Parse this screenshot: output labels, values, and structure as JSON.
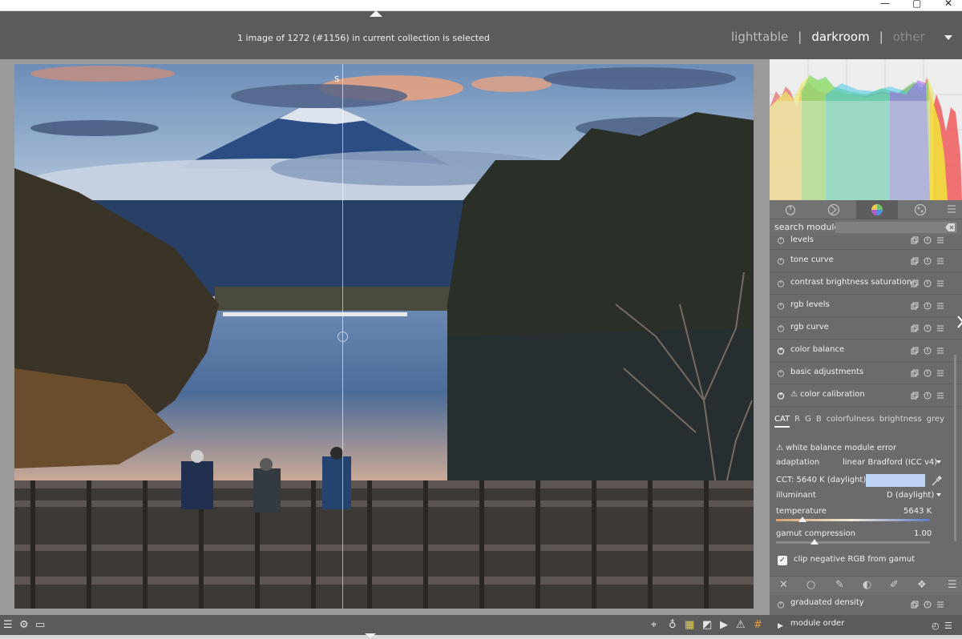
{
  "status_text": "1 image of 1272 (#1156) in current collection is selected",
  "views": {
    "lighttable": "lighttable",
    "darkroom": "darkroom",
    "other": "other",
    "separator": "|"
  },
  "search": {
    "label": "search module",
    "value": ""
  },
  "modules": [
    {
      "name": "levels",
      "enabled": false
    },
    {
      "name": "tone curve",
      "enabled": false
    },
    {
      "name": "contrast brightness saturation",
      "enabled": false
    },
    {
      "name": "rgb levels",
      "enabled": false
    },
    {
      "name": "rgb curve",
      "enabled": false
    },
    {
      "name": "color balance",
      "enabled": true
    },
    {
      "name": "basic adjustments",
      "enabled": false
    },
    {
      "name": "color calibration",
      "enabled": true,
      "warning": "⚠"
    }
  ],
  "color_calibration": {
    "tabs": [
      "CAT",
      "R",
      "G",
      "B",
      "colorfulness",
      "brightness",
      "grey"
    ],
    "active_tab": "CAT",
    "warning_text": "white balance module error",
    "warning_icon": "⚠",
    "adaptation_label": "adaptation",
    "adaptation_value": "linear Bradford (ICC v4)",
    "cct_label": "CCT: 5640 K (daylight)",
    "cct_swatch_color": "#bcd3f5",
    "illuminant_label": "illuminant",
    "illuminant_value": "D (daylight)",
    "temperature_label": "temperature",
    "temperature_value": "5643 K",
    "temperature_position": 0.17,
    "gamut_label": "gamut compression",
    "gamut_value": "1.00",
    "gamut_position": 0.25,
    "clip_label": "clip negative RGB from gamut",
    "clip_checked": true
  },
  "after_modules": [
    {
      "name": "graduated density",
      "enabled": false
    }
  ],
  "module_order": {
    "label": "module order"
  },
  "split_marker": "S",
  "icons": {
    "power": "power-icon",
    "multi_instance": "multi-instance-icon",
    "reset": "reset-icon",
    "presets": "presets-icon",
    "picker": "color-picker-icon"
  },
  "colors": {
    "panel_bg": "#6b6b6b",
    "header_bg": "#5b5b5b",
    "center_bg": "#9a9a9a",
    "histogram_bg": "#ededed",
    "swatch": "#bcd3f5"
  }
}
